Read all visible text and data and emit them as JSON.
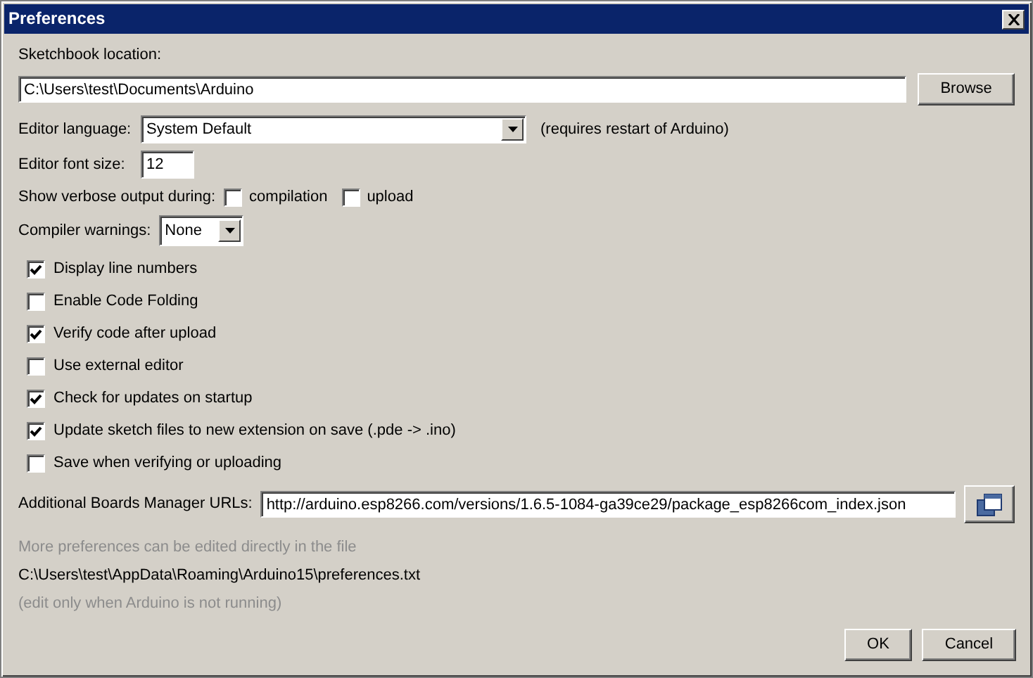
{
  "window": {
    "title": "Preferences"
  },
  "sketchbook": {
    "label": "Sketchbook location:",
    "value": "C:\\Users\\test\\Documents\\Arduino",
    "button": "Browse"
  },
  "editor_language": {
    "label": "Editor language:",
    "value": "System Default",
    "note": "(requires restart of Arduino)"
  },
  "editor_font_size": {
    "label": "Editor font size:",
    "value": "12"
  },
  "verbose_output": {
    "label": "Show verbose output during:",
    "options": [
      {
        "label": "compilation",
        "checked": false
      },
      {
        "label": "upload",
        "checked": false
      }
    ]
  },
  "compiler_warnings": {
    "label": "Compiler warnings:",
    "value": "None"
  },
  "options": [
    {
      "label": "Display line numbers",
      "checked": true
    },
    {
      "label": "Enable Code Folding",
      "checked": false
    },
    {
      "label": "Verify code after upload",
      "checked": true
    },
    {
      "label": "Use external editor",
      "checked": false
    },
    {
      "label": "Check for updates on startup",
      "checked": true
    },
    {
      "label": "Update sketch files to new extension on save (.pde -> .ino)",
      "checked": true
    },
    {
      "label": "Save when verifying or uploading",
      "checked": false
    }
  ],
  "boards_manager": {
    "label": "Additional Boards Manager URLs:",
    "value": "http://arduino.esp8266.com/versions/1.6.5-1084-ga39ce29/package_esp8266com_index.json"
  },
  "notes": [
    {
      "text": "More preferences can be edited directly in the file",
      "kind": "muted"
    },
    {
      "text": "C:\\Users\\test\\AppData\\Roaming\\Arduino15\\preferences.txt",
      "kind": "normal"
    },
    {
      "text": "(edit only when Arduino is not running)",
      "kind": "muted"
    }
  ],
  "buttons": [
    "OK",
    "Cancel"
  ]
}
